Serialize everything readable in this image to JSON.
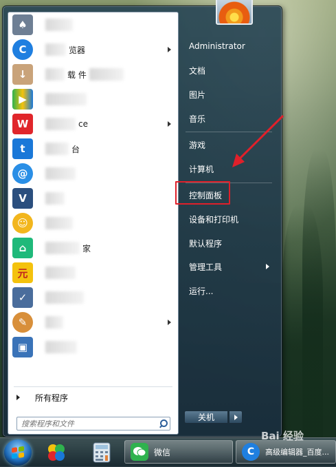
{
  "start_menu": {
    "programs": [
      {
        "icon": "solitaire-card-icon",
        "color": "#6e7f94",
        "glyph": "♠",
        "text": ""
      },
      {
        "icon": "browser-c-icon",
        "color": "#1f7fe0",
        "glyph": "C",
        "text": "览器",
        "submenu": true
      },
      {
        "icon": "download-tool-icon",
        "color": "#c9a37a",
        "glyph": "↓",
        "text": "载  件"
      },
      {
        "icon": "iqiyi-color-icon",
        "color": "#2fb24e",
        "glyph": "▶",
        "text": ""
      },
      {
        "icon": "wps-office-icon",
        "color": "#e0262b",
        "glyph": "W",
        "text": "ce",
        "submenu": true
      },
      {
        "icon": "platform-t-icon",
        "color": "#1a78d8",
        "glyph": "t",
        "text": "台"
      },
      {
        "icon": "at-sign-app-icon",
        "color": "#2a8fe6",
        "glyph": "@",
        "text": ""
      },
      {
        "icon": "v-app-icon",
        "color": "#2b4f7e",
        "glyph": "V",
        "text": ""
      },
      {
        "icon": "smiley-app-icon",
        "color": "#f2b61d",
        "glyph": "☺",
        "text": ""
      },
      {
        "icon": "home-app-icon",
        "color": "#1fb97a",
        "glyph": "⌂",
        "text": "家"
      },
      {
        "icon": "yuan-app-icon",
        "color": "#f4c20d",
        "glyph": "元",
        "text": ""
      },
      {
        "icon": "monitor-check-icon",
        "color": "#4a6d9c",
        "glyph": "✓",
        "text": ""
      },
      {
        "icon": "paint-palette-icon",
        "color": "#d88f3a",
        "glyph": "✎",
        "text": "",
        "submenu": true
      },
      {
        "icon": "computer-monitor-icon",
        "color": "#3a73b8",
        "glyph": "▣",
        "text": ""
      }
    ],
    "all_programs": "所有程序",
    "search_placeholder": "搜索程序和文件",
    "right_items": [
      {
        "label": "Administrator"
      },
      {
        "label": "文档"
      },
      {
        "label": "图片"
      },
      {
        "label": "音乐"
      },
      {
        "label": "游戏"
      },
      {
        "label": "计算机"
      },
      {
        "label": "控制面板"
      },
      {
        "label": "设备和打印机"
      },
      {
        "label": "默认程序"
      },
      {
        "label": "管理工具",
        "submenu": true
      },
      {
        "label": "运行..."
      }
    ],
    "shutdown_label": "关机",
    "highlight_color": "#e0202a"
  },
  "taskbar": {
    "wechat_label": "微信",
    "browser_label": "高级编辑器_百度...",
    "watermark": "Bai 经验"
  }
}
